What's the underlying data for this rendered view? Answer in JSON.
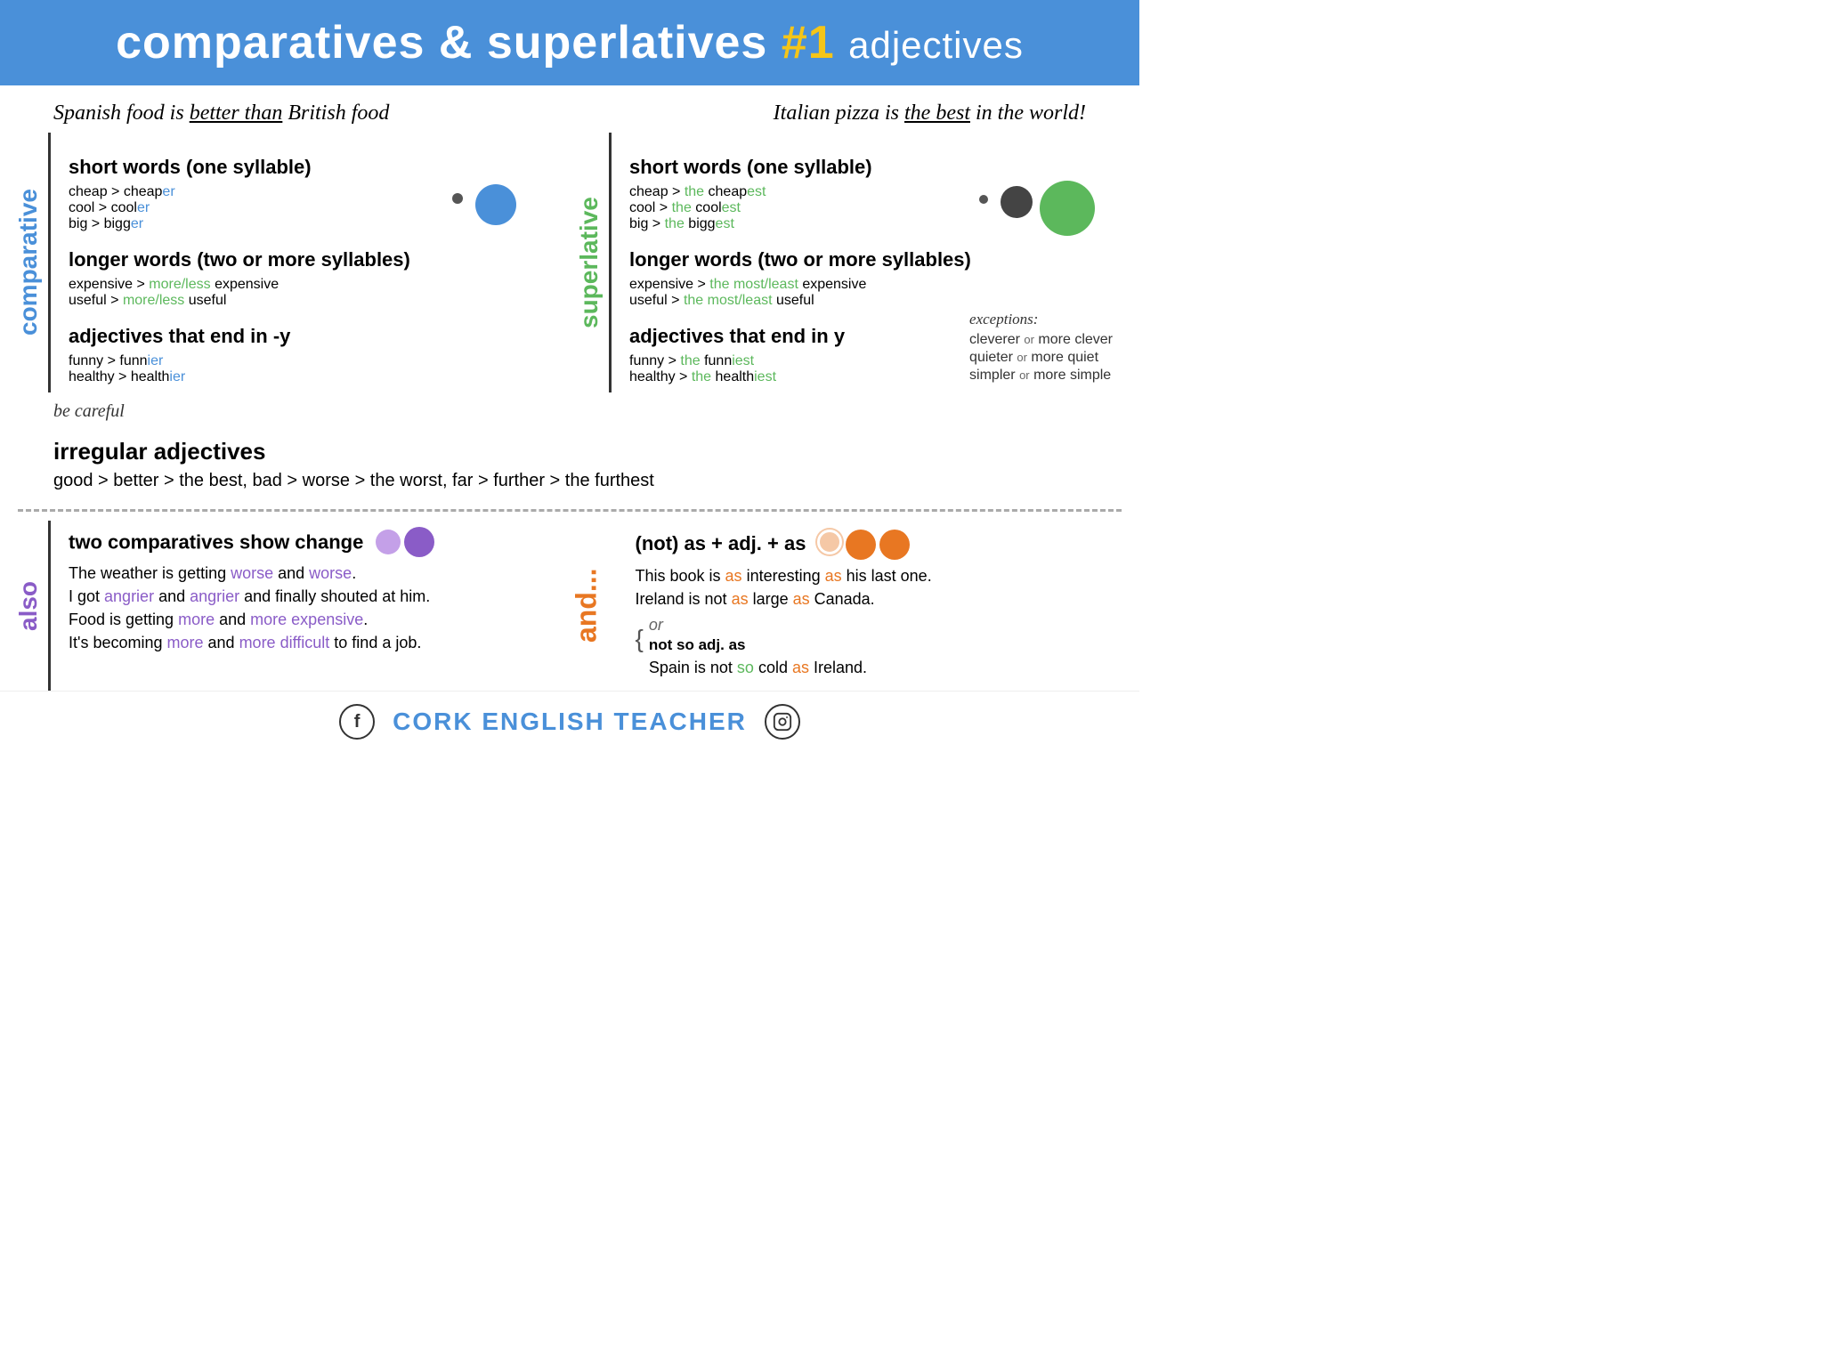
{
  "header": {
    "title": "comparatives & superlatives",
    "number": "#1",
    "adjectives_label": "adjectives"
  },
  "examples": {
    "left": "Spanish food is better than British food",
    "right": "Italian pizza is the best in the world!"
  },
  "comparative": {
    "label": "comparative",
    "short_words_title": "short words (one syllable)",
    "short_words": [
      {
        "base": "cheap > cheap",
        "suffix": "er"
      },
      {
        "base": "cool > cool",
        "suffix": "er"
      },
      {
        "base": "big > bigg",
        "suffix": "er"
      }
    ],
    "longer_words_title": "longer words (two or more syllables)",
    "longer_words": [
      {
        "base": "expensive > ",
        "highlight": "more/less",
        "rest": " expensive"
      },
      {
        "base": "useful > ",
        "highlight": "more/less",
        "rest": " useful"
      }
    ],
    "end_y_title": "adjectives that end in -y",
    "end_y": [
      {
        "base": "funny > funn",
        "suffix": "ier"
      },
      {
        "base": "healthy > health",
        "suffix": "ier"
      }
    ]
  },
  "superlative": {
    "label": "superlative",
    "short_words_title": "short words (one syllable)",
    "short_words": [
      {
        "base": "cheap > ",
        "the": "the",
        " ": " cheap",
        "suffix": "est"
      },
      {
        "base": "cool > ",
        "the": "the",
        " ": " cool",
        "suffix": "est"
      },
      {
        "base": "big > ",
        "the": "the",
        " ": " bigg",
        "suffix": "est"
      }
    ],
    "longer_words_title": "longer words (two or more syllables)",
    "longer_words": [
      {
        "base": "expensive > ",
        "highlight": "the most/least",
        "rest": " expensive"
      },
      {
        "base": "useful > ",
        "highlight": "the most/least",
        "rest": " useful"
      }
    ],
    "end_y_title": "adjectives that end in y",
    "end_y": [
      {
        "base": "funny > ",
        "the": "the",
        " ": " funn",
        "suffix": "iest"
      },
      {
        "base": "healthy > ",
        "the": "the",
        " ": " health",
        "suffix": "iest"
      }
    ],
    "exceptions_title": "exceptions:",
    "exceptions": [
      {
        "text": "cleverer",
        "small": "or",
        "rest": " more clever"
      },
      {
        "text": "quieter",
        "small": "or",
        "rest": " more quiet"
      },
      {
        "text": "simpler",
        "small": "or",
        "rest": " more simple"
      }
    ]
  },
  "irregular": {
    "be_careful": "be careful",
    "title": "irregular adjectives",
    "text": "good > better > the best, bad > worse > the worst, far > further > the furthest"
  },
  "also": {
    "label": "also",
    "two_comparatives_title": "two comparatives show change",
    "two_comparatives_examples": [
      {
        "text": "The weather is getting ",
        "w1": "worse",
        "mid": " and ",
        "w2": "worse",
        "end": "."
      },
      {
        "text": "I got ",
        "w1": "angrier",
        "mid": " and ",
        "w2": "angrier",
        "end": " and finally shouted at him."
      },
      {
        "text": "Food is getting ",
        "w1": "more",
        "mid": " and ",
        "w2": "more",
        "end3": " expensive",
        "end": "."
      },
      {
        "text": "It's becoming ",
        "w1": "more",
        "mid": " and ",
        "w2": "more",
        "end3": " difficult",
        "end": " to find a job."
      }
    ],
    "not_as_title": "(not) as + adj. + as",
    "not_as_examples": [
      {
        "text": "This book is ",
        "as1": "as",
        "adj": " interesting ",
        "as2": "as",
        "end": " his last one."
      },
      {
        "text": "Ireland is not ",
        "as1": "as",
        "adj": " large ",
        "as2": "as",
        "end": " Canada."
      }
    ],
    "or_label": "or",
    "not_so_label": "not so adj. as",
    "not_so_example": "Spain is not so cold as Ireland.",
    "not_so_so": "so",
    "not_so_as": "as"
  },
  "footer": {
    "brand": "CORK ENGLISH TEACHER",
    "facebook_icon": "f",
    "instagram_icon": "📷"
  }
}
